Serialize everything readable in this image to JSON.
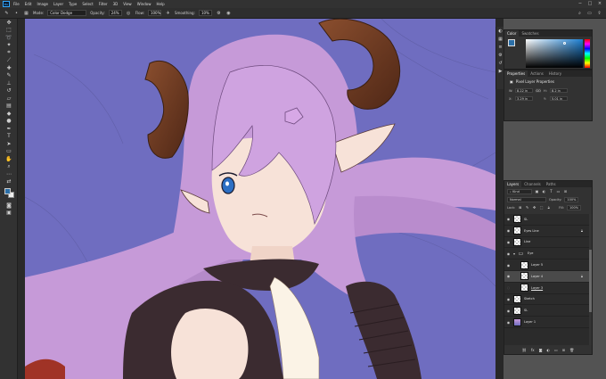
{
  "app": {
    "logo": "Ps"
  },
  "menu": [
    "File",
    "Edit",
    "Image",
    "Layer",
    "Type",
    "Select",
    "Filter",
    "3D",
    "View",
    "Window",
    "Help"
  ],
  "options": {
    "brush_size": "•",
    "mode_label": "Mode:",
    "mode_value": "Color Dodge",
    "opacity_label": "Opacity:",
    "opacity_value": "24%",
    "flow_label": "Flow:",
    "flow_value": "100%",
    "smoothing_label": "Smoothing:",
    "smoothing_value": "10%"
  },
  "color_panel": {
    "tabs": [
      "Color",
      "Swatches"
    ],
    "foreground": "#2b6fa8"
  },
  "properties_panel": {
    "tabs": [
      "Properties",
      "Actions",
      "History"
    ],
    "title": "Pixel Layer Properties",
    "w_label": "W:",
    "w_value": "8.22 in",
    "h_label": "H:",
    "h_value": "8.2 in",
    "x_label": "X:",
    "x_value": "3.29 in",
    "y_label": "Y:",
    "y_value": "5.01 in",
    "link_label": "GO"
  },
  "layers_panel": {
    "tabs": [
      "Layers",
      "Channels",
      "Paths"
    ],
    "filter_kind": "Kind",
    "blend_mode": "Normal",
    "opacity_label": "Opacity:",
    "opacity_value": "100%",
    "lock_label": "Lock:",
    "fill_label": "Fill:",
    "fill_value": "100%",
    "layers": [
      {
        "name": "SL",
        "thumb": "checker",
        "visible": true
      },
      {
        "name": "Eyes Line",
        "thumb": "checker",
        "visible": true
      },
      {
        "name": "Line",
        "thumb": "checker",
        "visible": true
      },
      {
        "name": "Eye",
        "thumb": "folder",
        "visible": true
      },
      {
        "name": "Layer 5",
        "thumb": "checker",
        "visible": true
      },
      {
        "name": "Layer 4",
        "thumb": "checker",
        "visible": true,
        "selected": true
      },
      {
        "name": "Layer 3",
        "thumb": "checker",
        "visible": false
      },
      {
        "name": "Sketch",
        "thumb": "checker",
        "visible": true
      },
      {
        "name": "SL",
        "thumb": "checker",
        "visible": true
      },
      {
        "name": "Layer 1",
        "thumb": "art",
        "visible": true
      }
    ]
  },
  "colors": {
    "canvas_bg": "#6f6dc0",
    "hair": "#c69ad8",
    "horn": "#6b3a22",
    "skin": "#f7e2d8",
    "outfit": "#3b2b30",
    "accent": "#31a8ff"
  }
}
